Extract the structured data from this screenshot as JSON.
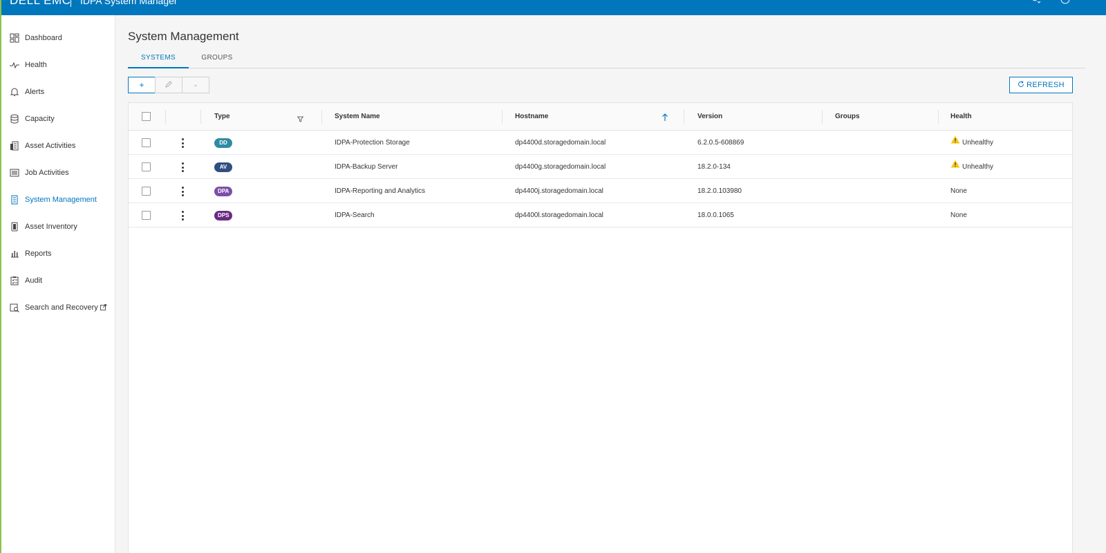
{
  "header": {
    "brand": "DELL EMC",
    "app_title": "IDPA System Manager",
    "user_icon": "user-icon",
    "help_icon": "info-icon"
  },
  "sidebar": {
    "items": [
      {
        "label": "Dashboard",
        "icon": "dashboard-icon"
      },
      {
        "label": "Health",
        "icon": "pulse-icon"
      },
      {
        "label": "Alerts",
        "icon": "bell-icon"
      },
      {
        "label": "Capacity",
        "icon": "database-icon"
      },
      {
        "label": "Asset Activities",
        "icon": "asset-activities-icon"
      },
      {
        "label": "Job Activities",
        "icon": "list-icon"
      },
      {
        "label": "System Management",
        "icon": "server-icon",
        "active": true
      },
      {
        "label": "Asset Inventory",
        "icon": "inventory-icon"
      },
      {
        "label": "Reports",
        "icon": "bar-chart-icon"
      },
      {
        "label": "Audit",
        "icon": "clipboard-icon"
      },
      {
        "label": "Search and Recovery",
        "icon": "search-doc-icon",
        "external": true
      }
    ]
  },
  "main": {
    "title": "System Management",
    "tabs": [
      {
        "label": "SYSTEMS",
        "active": true
      },
      {
        "label": "GROUPS",
        "active": false
      }
    ],
    "toolbar": {
      "add": "+",
      "edit_icon": "pencil-icon",
      "delete": "-",
      "refresh_label": "REFRESH"
    },
    "table": {
      "columns": [
        "Type",
        "System Name",
        "Hostname",
        "Version",
        "Groups",
        "Health"
      ],
      "sort": {
        "column": "Hostname",
        "direction": "ascending"
      },
      "rows": [
        {
          "type": "DD",
          "type_color": "#2e8ba3",
          "name": "IDPA-Protection Storage",
          "hostname": "dp4400d.storagedomain.local",
          "version": "6.2.0.5-608869",
          "groups": "",
          "health": "Unhealthy",
          "warn": true
        },
        {
          "type": "AV",
          "type_color": "#2f4f7f",
          "name": "IDPA-Backup Server",
          "hostname": "dp4400g.storagedomain.local",
          "version": "18.2.0-134",
          "groups": "",
          "health": "Unhealthy",
          "warn": true
        },
        {
          "type": "DPA",
          "type_color": "#7b4fa8",
          "name": "IDPA-Reporting and Analytics",
          "hostname": "dp4400j.storagedomain.local",
          "version": "18.2.0.103980",
          "groups": "",
          "health": "None",
          "warn": false
        },
        {
          "type": "DPS",
          "type_color": "#6a2c82",
          "name": "IDPA-Search",
          "hostname": "dp4400l.storagedomain.local",
          "version": "18.0.0.1065",
          "groups": "",
          "health": "None",
          "warn": false
        }
      ]
    }
  },
  "colors": {
    "accent": "#0076bd",
    "warning": "#f5c518"
  }
}
